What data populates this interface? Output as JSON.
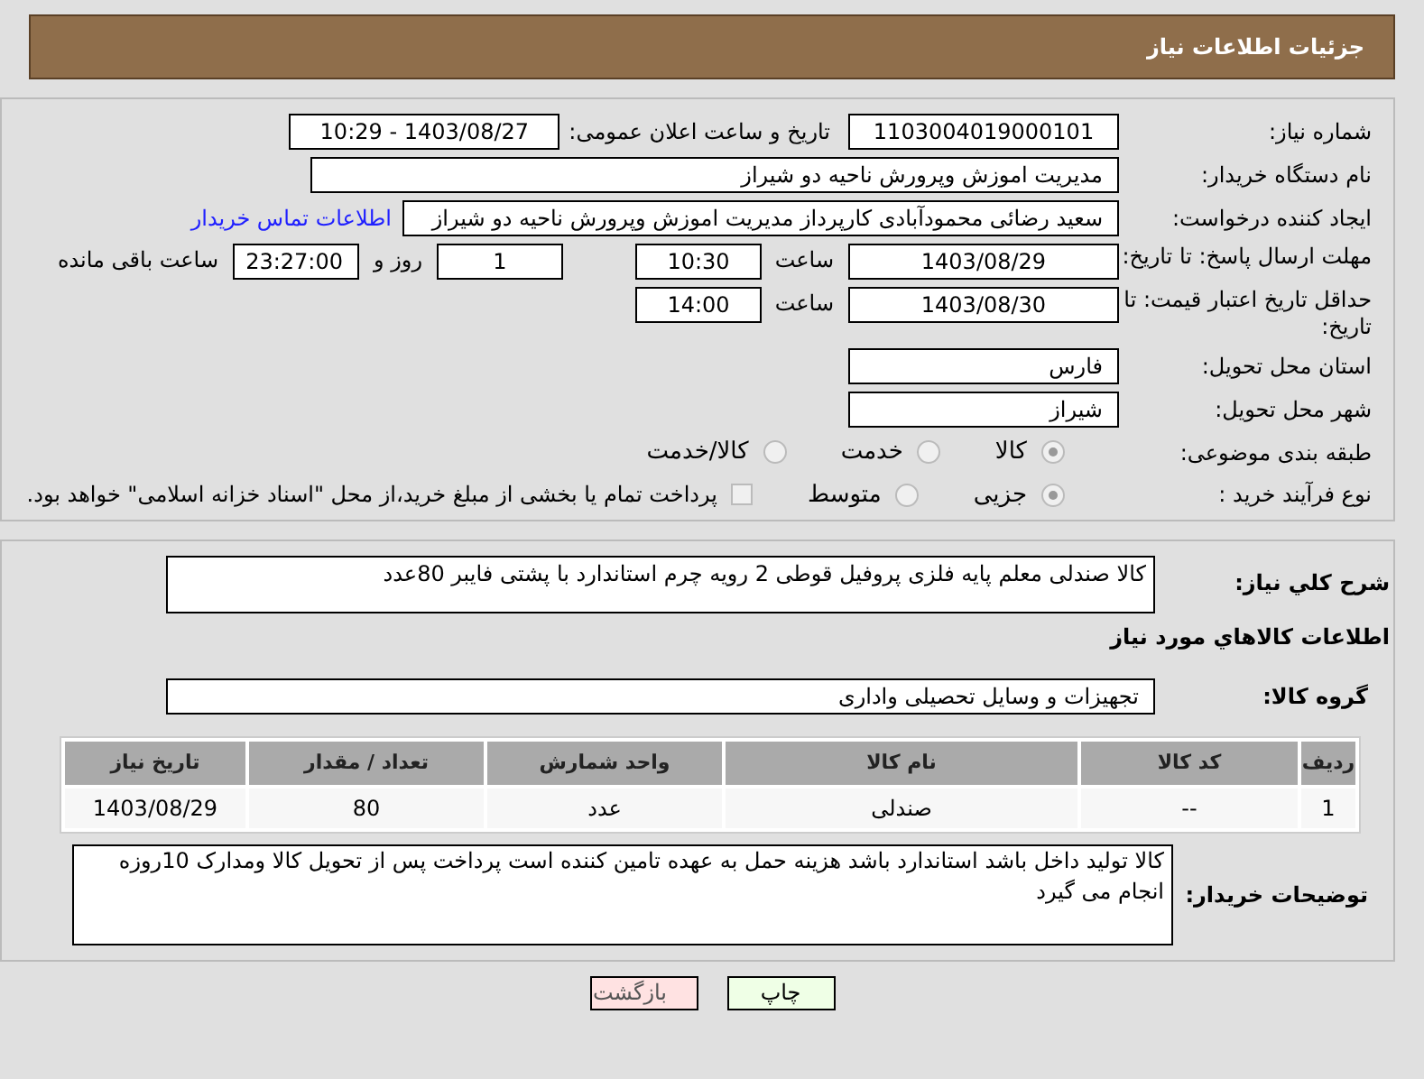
{
  "header": {
    "title": "جزئیات اطلاعات نیاز"
  },
  "fields": {
    "need_number": {
      "label": "شماره نیاز:",
      "value": "1103004019000101"
    },
    "announce": {
      "label": "تاریخ و ساعت اعلان عمومی:",
      "value": "1403/08/27 - 10:29"
    },
    "buyer": {
      "label": "نام دستگاه خریدار:",
      "value": "مدیریت اموزش وپرورش ناحیه دو شیراز"
    },
    "creator": {
      "label": "ایجاد کننده درخواست:",
      "value": "سعید رضائی محمودآبادی کارپرداز مدیریت اموزش وپرورش ناحیه دو شیراز",
      "link": "اطلاعات تماس خریدار"
    },
    "deadline": {
      "label": "مهلت ارسال پاسخ: تا تاریخ:",
      "date": "1403/08/29",
      "time_label": "ساعت",
      "time": "10:30",
      "days": "1",
      "days_label": "روز و",
      "remaining": "23:27:00",
      "remaining_label": "ساعت باقی مانده"
    },
    "validity": {
      "label": "حداقل تاریخ اعتبار قیمت: تا تاریخ:",
      "date": "1403/08/30",
      "time_label": "ساعت",
      "time": "14:00"
    },
    "province": {
      "label": "استان محل تحویل:",
      "value": "فارس"
    },
    "city": {
      "label": "شهر محل تحویل:",
      "value": "شیراز"
    },
    "category": {
      "label": "طبقه بندی موضوعی:",
      "options": [
        {
          "label": "کالا",
          "selected": true
        },
        {
          "label": "خدمت",
          "selected": false
        },
        {
          "label": "کالا/خدمت",
          "selected": false
        }
      ]
    },
    "process": {
      "label": "نوع فرآیند خرید :",
      "options": [
        {
          "label": "جزیی",
          "selected": true
        },
        {
          "label": "متوسط",
          "selected": false
        }
      ],
      "payment": {
        "checked": false,
        "label": "پرداخت تمام یا بخشی از مبلغ خرید،از محل \"اسناد خزانه اسلامی\" خواهد بود."
      }
    }
  },
  "description": {
    "label": "شرح کلي نياز:",
    "value": "کالا صندلی معلم پایه فلزی  پروفیل قوطی 2  رویه چرم استاندارد با پشتی فایبر 80عدد"
  },
  "goods_title": "اطلاعات کالاهاي مورد نياز",
  "group": {
    "label": "گروه کالا:",
    "value": "تجهیزات و وسایل تحصیلی واداری"
  },
  "table": {
    "columns": [
      "ردیف",
      "کد کالا",
      "نام کالا",
      "واحد شمارش",
      "تعداد / مقدار",
      "تاریخ نیاز"
    ],
    "rows": [
      [
        "1",
        "--",
        "صندلی",
        "عدد",
        "80",
        "1403/08/29"
      ]
    ]
  },
  "notes": {
    "label": "توضیحات خریدار:",
    "value": "کالا تولید داخل باشد استاندارد باشد هزینه حمل به عهده تامین کننده است پرداخت پس از تحویل کالا ومدارک 10روزه انجام می گیرد"
  },
  "buttons": [
    {
      "kind": "print",
      "label": "چاپ"
    },
    {
      "kind": "back",
      "label": "بازگشت"
    }
  ]
}
